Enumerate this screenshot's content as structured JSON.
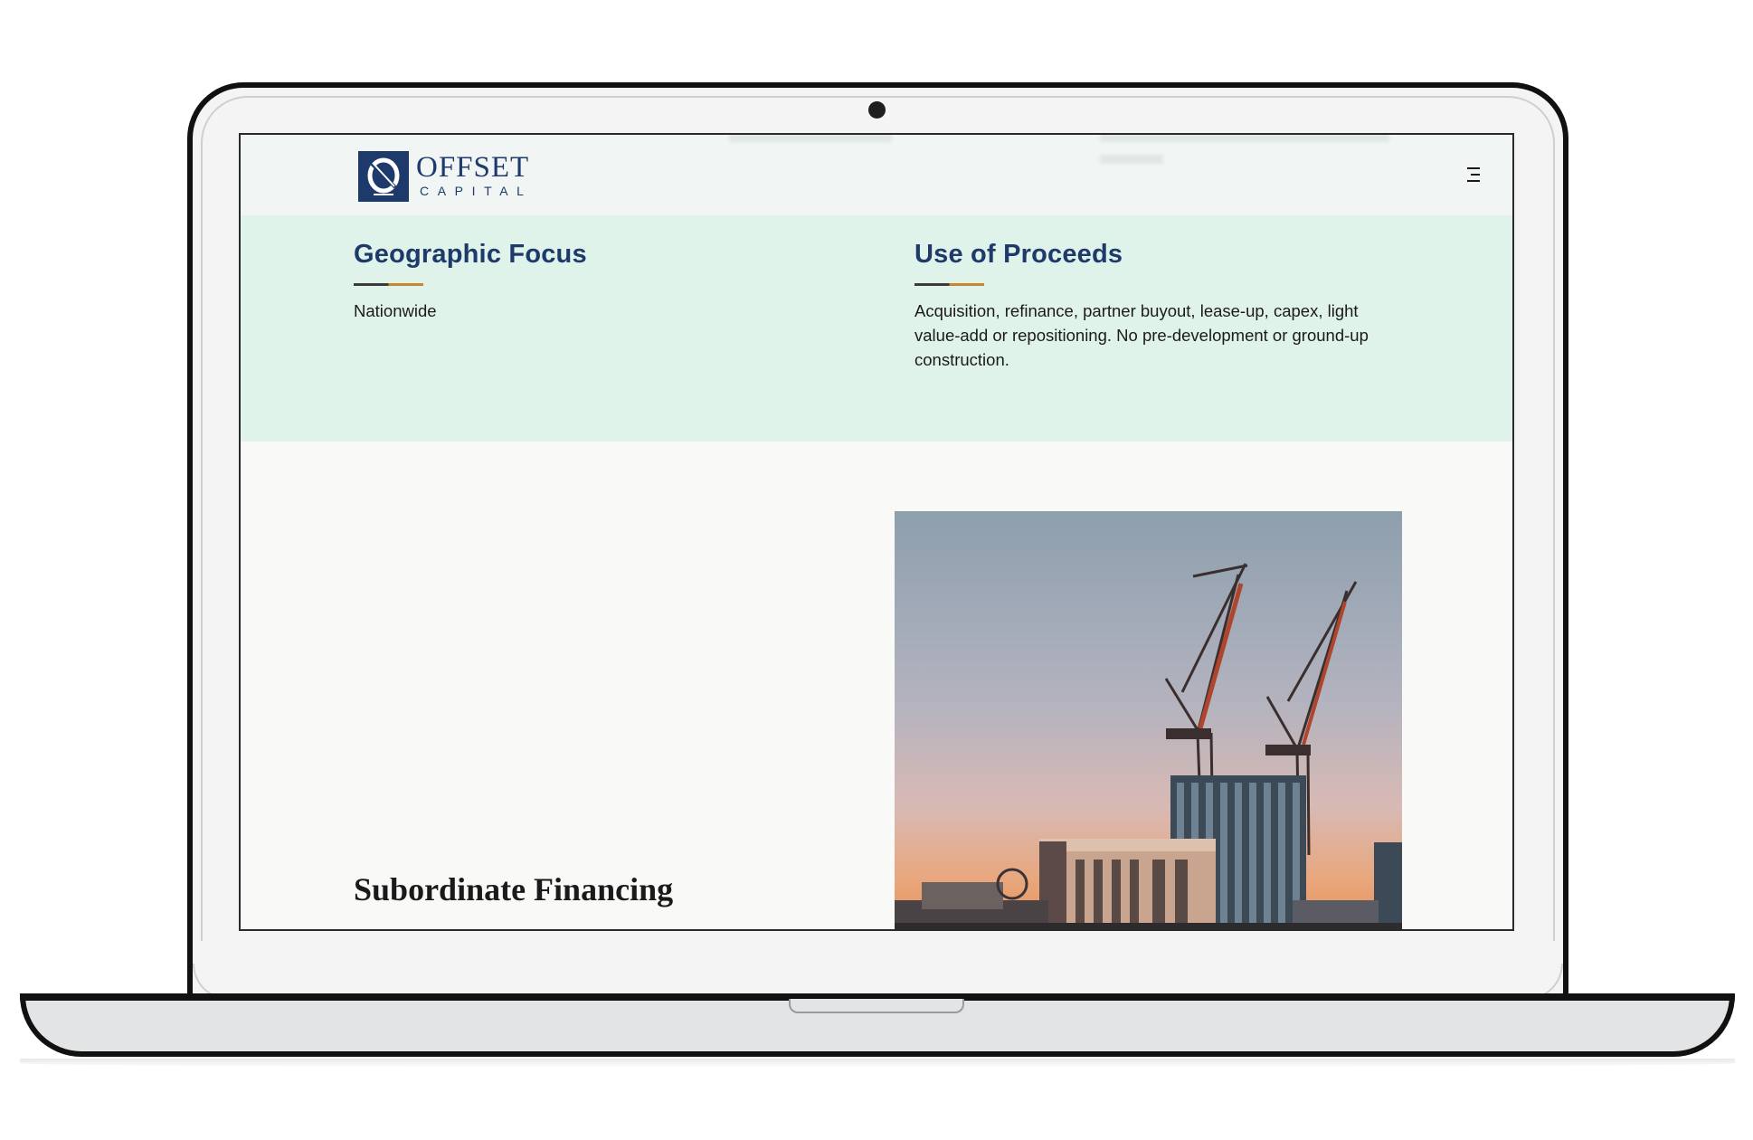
{
  "header": {
    "logo": {
      "word": "OFFSET",
      "sub": "CAPITAL"
    },
    "menu_icon": "menu-icon"
  },
  "features": [
    {
      "title": "Geographic Focus",
      "text": "Nationwide"
    },
    {
      "title": "Use of Proceeds",
      "text": "Acquisition, refinance, partner buyout, lease-up, capex, light value-add or repositioning. No pre-development or ground-up construction."
    }
  ],
  "section": {
    "title": "Subordinate Financing"
  },
  "colors": {
    "brand_navy": "#1d3a6b",
    "accent_orange": "#c8842f",
    "mint_band": "#e0f3ea",
    "header_bg": "#f1f6f4",
    "page_bg": "#f9f9f7"
  }
}
